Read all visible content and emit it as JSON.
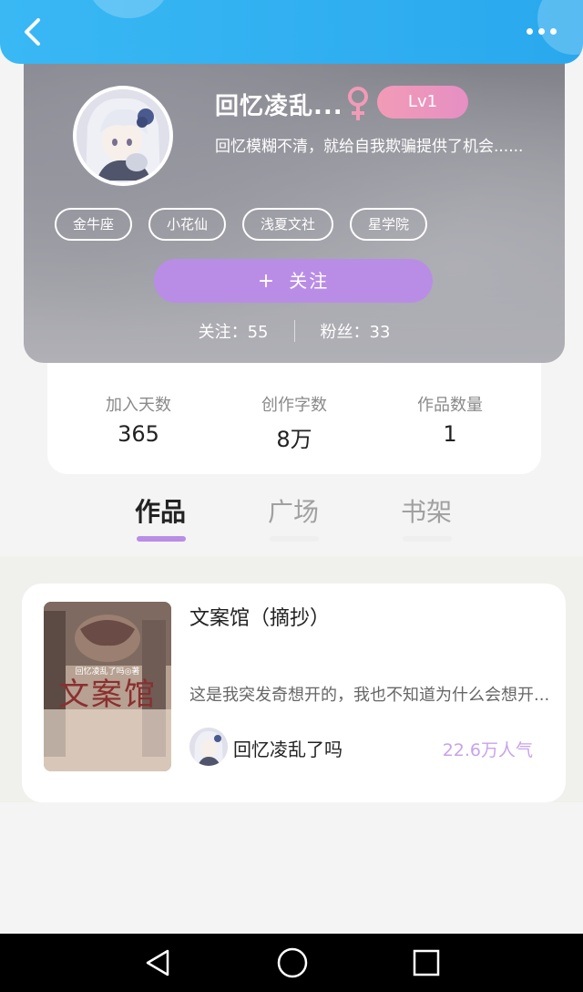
{
  "header": {
    "back_icon": "chevron-left-icon",
    "more_icon": "more-dots-icon",
    "color": "#35b2f2"
  },
  "profile": {
    "username": "回忆凌乱...",
    "gender_icon": "female-icon",
    "gender_color": "#f29bb6",
    "level": "Lv1",
    "bio": "回忆模糊不清，就给自我欺骗提供了机会......",
    "tags": [
      "金牛座",
      "小花仙",
      "浅夏文社",
      "星学院"
    ],
    "follow_plus": "+",
    "follow_label": "关注",
    "following_label": "关注：55",
    "followers_label": "粉丝：33"
  },
  "stats": [
    {
      "label": "加入天数",
      "value": "365"
    },
    {
      "label": "创作字数",
      "value": "8万"
    },
    {
      "label": "作品数量",
      "value": "1"
    }
  ],
  "tabs": [
    {
      "label": "作品",
      "active": true
    },
    {
      "label": "广场",
      "active": false
    },
    {
      "label": "书架",
      "active": false
    }
  ],
  "accent_color": "#b98de6",
  "book": {
    "title": "文案馆（摘抄）",
    "cover_text": "文案馆",
    "cover_byline": "回忆凌乱了吗◎著",
    "description": "这是我突发奇想开的，我也不知道为什么会想开...",
    "author": "回忆凌乱了吗",
    "popularity": "22.6万人气"
  },
  "navbar": {
    "back_icon": "nav-back-icon",
    "home_icon": "nav-home-icon",
    "recents_icon": "nav-recents-icon"
  }
}
